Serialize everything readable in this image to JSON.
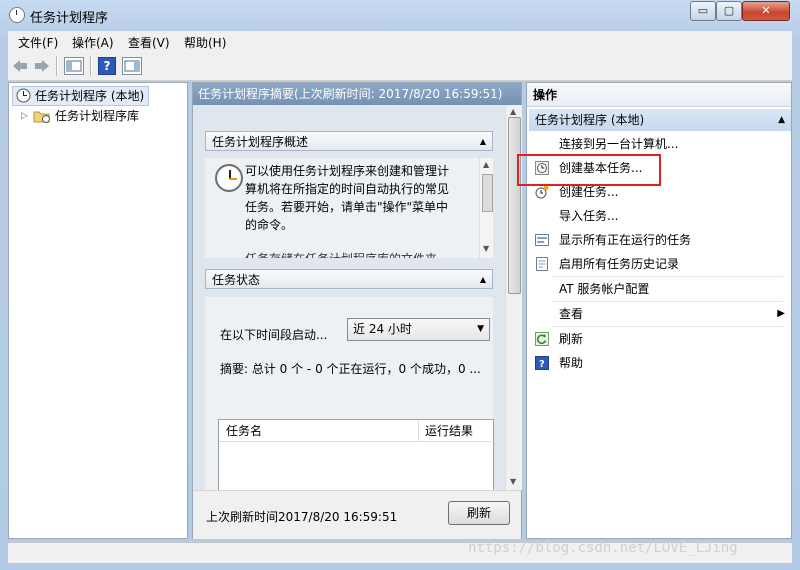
{
  "window": {
    "title": "任务计划程序",
    "controls": {
      "minimize": "▭",
      "maximize": "▢",
      "close": "✕"
    }
  },
  "menu": [
    "文件(F)",
    "操作(A)",
    "查看(V)",
    "帮助(H)"
  ],
  "toolbar": {
    "icons": [
      "back-arrow-icon",
      "forward-arrow-icon",
      "console-tree-icon",
      "help-icon",
      "action-pane-icon"
    ],
    "help_glyph": "?"
  },
  "tree": {
    "root": "任务计划程序 (本地)",
    "library": "任务计划程序库",
    "expander": "▷"
  },
  "center": {
    "header": "任务计划程序摘要(上次刷新时间: 2017/8/20 16:59:51)",
    "overview": {
      "title": "任务计划程序概述",
      "text": "可以使用任务计划程序来创建和管理计算机将在所指定的时间自动执行的常见任务。若要开始，请单击\"操作\"菜单中的命令。",
      "more": "任务存储在任务计划程序库的文件夹"
    },
    "status": {
      "title": "任务状态",
      "range_label": "在以下时间段启动...",
      "range_value": "近 24 小时",
      "summary": "摘要: 总计 0 个 - 0 个正在运行，0 个成功，0 ...",
      "columns": [
        "任务名",
        "运行结果"
      ]
    },
    "footer": {
      "last_refresh": "上次刷新时间2017/8/20 16:59:51",
      "refresh_button": "刷新"
    },
    "caret_up": "▲",
    "caret_down": "▼"
  },
  "actions": {
    "header": "操作",
    "group": "任务计划程序 (本地)",
    "items": [
      {
        "label": "连接到另一台计算机...",
        "icon": ""
      },
      {
        "label": "创建基本任务...",
        "icon": "create-basic-task-icon"
      },
      {
        "label": "创建任务...",
        "icon": "create-task-icon"
      },
      {
        "label": "导入任务...",
        "icon": ""
      },
      {
        "label": "显示所有正在运行的任务",
        "icon": "running-tasks-icon"
      },
      {
        "label": "启用所有任务历史记录",
        "icon": "history-icon"
      },
      {
        "label": "AT 服务帐户配置",
        "icon": ""
      },
      {
        "label": "查看",
        "icon": ""
      },
      {
        "label": "刷新",
        "icon": "refresh-icon"
      },
      {
        "label": "帮助",
        "icon": "help-icon"
      }
    ],
    "submenu_arrow": "▶"
  },
  "highlight_color": "#e32020",
  "watermark": "https://blog.csdn.net/LOVE_LJing"
}
